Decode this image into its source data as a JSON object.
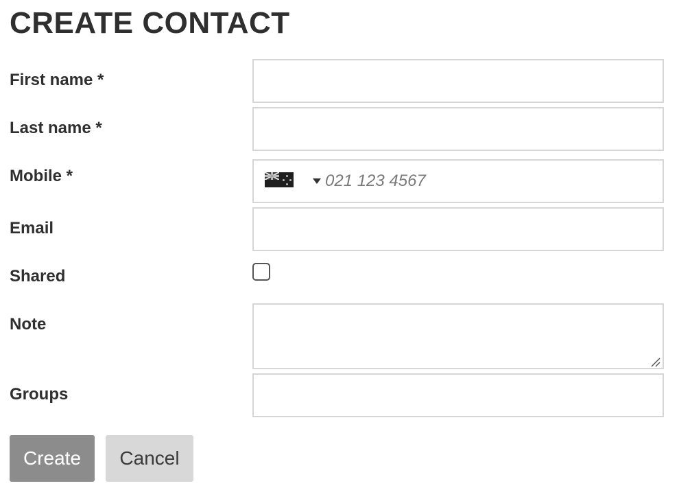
{
  "page": {
    "title": "CREATE CONTACT"
  },
  "form": {
    "first_name": {
      "label": "First name *",
      "value": ""
    },
    "last_name": {
      "label": "Last name *",
      "value": ""
    },
    "mobile": {
      "label": "Mobile *",
      "country_flag": "NZ",
      "placeholder": "021 123 4567",
      "value": ""
    },
    "email": {
      "label": "Email",
      "value": ""
    },
    "shared": {
      "label": "Shared",
      "checked": false
    },
    "note": {
      "label": "Note",
      "value": ""
    },
    "groups": {
      "label": "Groups",
      "value": ""
    }
  },
  "actions": {
    "create_label": "Create",
    "cancel_label": "Cancel"
  },
  "colors": {
    "create_bg": "#8c8c8c",
    "cancel_bg": "#d8d8d8",
    "field_border": "#d6d6d6",
    "text": "#2f2f2f"
  }
}
